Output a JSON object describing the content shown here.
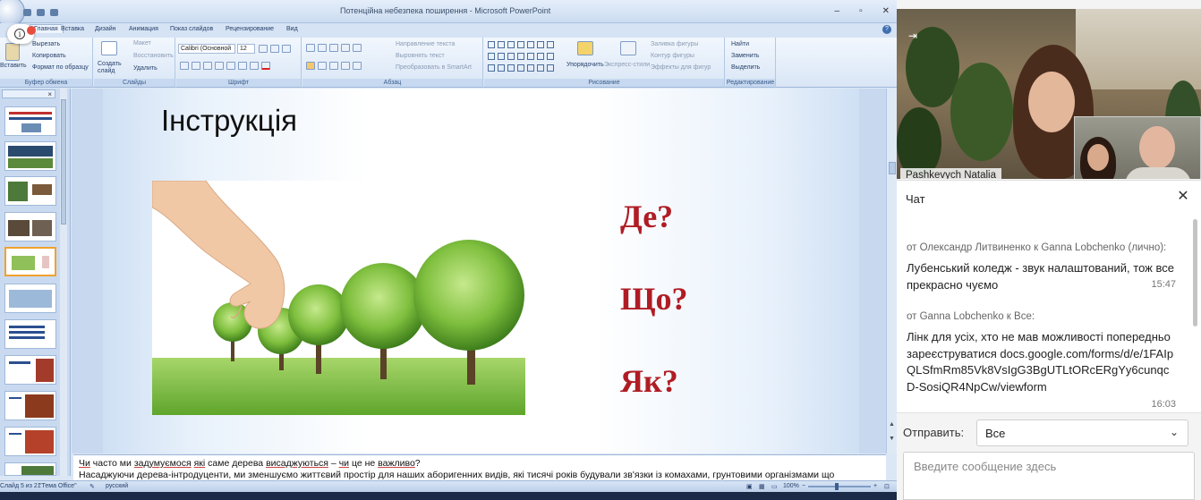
{
  "ppt": {
    "window_title": "Потенційна небезпека поширення - Microsoft PowerPoint",
    "tabs": [
      "Главная",
      "Вставка",
      "Дизайн",
      "Анимация",
      "Показ слайдов",
      "Рецензирование",
      "Вид"
    ],
    "ribbon": {
      "clipboard": {
        "label": "Буфер обмена",
        "paste": "Вставить",
        "cut": "Вырезать",
        "copy": "Копировать",
        "format_painter": "Формат по образцу"
      },
      "slides": {
        "label": "Слайды",
        "new_slide": "Создать слайд",
        "layout": "Макет",
        "reset": "Восстановить",
        "delete": "Удалить"
      },
      "font": {
        "label": "Шрифт",
        "font_name": "Calibri (Основной",
        "font_size": "12"
      },
      "paragraph": {
        "label": "Абзац",
        "text_direction": "Направление текста",
        "align_text": "Выровнять текст",
        "smartart": "Преобразовать в SmartArt"
      },
      "drawing": {
        "label": "Рисование",
        "arrange": "Упорядочить",
        "quick_styles": "Экспресс-стили",
        "fill": "Заливка фигуры",
        "outline": "Контур фигуры",
        "effects": "Эффекты для фигур"
      },
      "editing": {
        "label": "Редактирование",
        "find": "Найти",
        "replace": "Заменить",
        "select": "Выделить"
      }
    },
    "slide": {
      "title": "Інструкція",
      "q1": "Де?",
      "q2": "Що?",
      "q3": "Як?"
    },
    "notes": {
      "line1_parts": [
        "Чи",
        " часто ми ",
        "задумуємося",
        " ",
        "які",
        " саме дерева ",
        "висаджуються",
        " – ",
        "чи",
        " це не ",
        "важливо",
        "?"
      ],
      "line2": "Насаджуючи дерева-інтродуценти, ми зменшуємо життєвий простір для наших аборигенних видів, які тисячі років будували зв'язки із комахами, грунтовими організмами що"
    },
    "status": {
      "slide_counter": "Слайд 5 из 21",
      "theme": "\"Тема Office\"",
      "language": "русский",
      "zoom": "100%"
    },
    "colors": {
      "question": "#b01c24",
      "ribbon_bg": "#dbe7f5",
      "active_thumb_border": "#f0a22e"
    }
  },
  "conference": {
    "speaker_name": "Pashkevych Natalia",
    "chat_title": "Чат",
    "messages": [
      {
        "from": "от Олександр Литвиненко к Ganna Lobchenko (лично):",
        "text": "Лубенський коледж - звук налаштований, тож все прекрасно чуємо",
        "time": "15:47"
      },
      {
        "from": "от Ganna Lobchenko к Все:",
        "text": "Лінк для усіх, хто не мав можливості попередньо зареєструватися docs.google.com/forms/d/e/1FAIpQLSfmRm85Vk8VsIgG3BgUTLtORcERgYy6cunqcD-SosiQR4NpCw/viewform",
        "time": "16:03"
      }
    ],
    "send_label": "Отправить:",
    "send_to": "Все",
    "input_placeholder": "Введите сообщение здесь"
  }
}
